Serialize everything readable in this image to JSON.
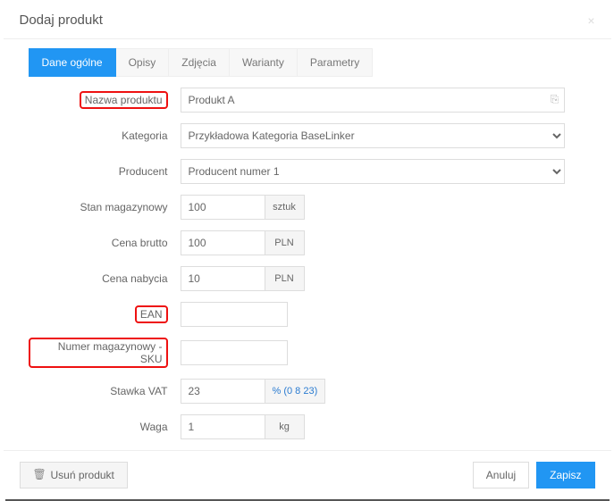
{
  "header": {
    "title": "Dodaj produkt"
  },
  "tabs": {
    "t0": "Dane ogólne",
    "t1": "Opisy",
    "t2": "Zdjęcia",
    "t3": "Warianty",
    "t4": "Parametry"
  },
  "labels": {
    "name": "Nazwa produktu",
    "category": "Kategoria",
    "producer": "Producent",
    "stock": "Stan magazynowy",
    "priceGross": "Cena brutto",
    "pricePurchase": "Cena nabycia",
    "ean": "EAN",
    "sku": "Numer magazynowy - SKU",
    "vat": "Stawka VAT",
    "weight": "Waga"
  },
  "values": {
    "name": "Produkt A",
    "category": "Przykładowa Kategoria BaseLinker",
    "producer": "Producent numer 1",
    "stock": "100",
    "priceGross": "100",
    "pricePurchase": "10",
    "ean": "",
    "sku": "",
    "vat": "23",
    "weight": "1"
  },
  "units": {
    "stock": "sztuk",
    "currency": "PLN",
    "vatHint": "% (0 8 23)",
    "weight": "kg"
  },
  "footer": {
    "delete": "Usuń produkt",
    "cancel": "Anuluj",
    "save": "Zapisz"
  }
}
